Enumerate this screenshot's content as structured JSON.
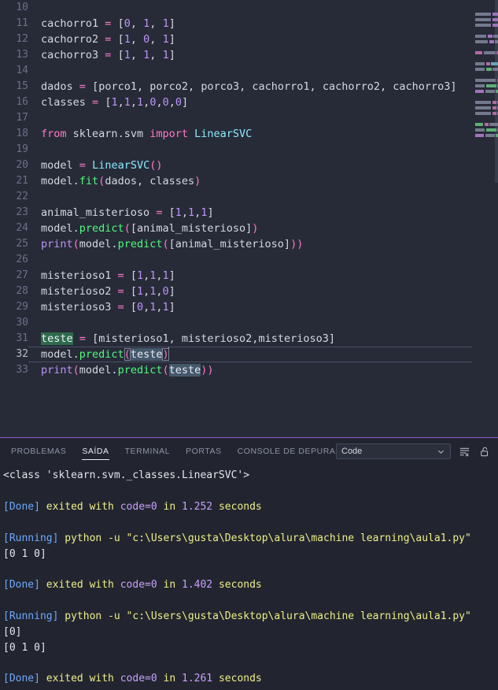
{
  "editor": {
    "language": "python",
    "first_visible_line": 10,
    "cursor_line": 32,
    "lines": [
      {
        "n": "10",
        "text": ""
      },
      {
        "n": "11",
        "text": "cachorro1 = [0, 1, 1]"
      },
      {
        "n": "12",
        "text": "cachorro2 = [1, 0, 1]"
      },
      {
        "n": "13",
        "text": "cachorro3 = [1, 1, 1]"
      },
      {
        "n": "14",
        "text": ""
      },
      {
        "n": "15",
        "text": "dados = [porco1, porco2, porco3, cachorro1, cachorro2, cachorro3]"
      },
      {
        "n": "16",
        "text": "classes = [1,1,1,0,0,0]"
      },
      {
        "n": "17",
        "text": ""
      },
      {
        "n": "18",
        "text": "from sklearn.svm import LinearSVC"
      },
      {
        "n": "19",
        "text": ""
      },
      {
        "n": "20",
        "text": "model = LinearSVC()"
      },
      {
        "n": "21",
        "text": "model.fit(dados, classes)"
      },
      {
        "n": "22",
        "text": ""
      },
      {
        "n": "23",
        "text": "animal_misterioso = [1,1,1]"
      },
      {
        "n": "24",
        "text": "model.predict([animal_misterioso])"
      },
      {
        "n": "25",
        "text": "print(model.predict([animal_misterioso]))"
      },
      {
        "n": "26",
        "text": ""
      },
      {
        "n": "27",
        "text": "misterioso1 = [1,1,1]"
      },
      {
        "n": "28",
        "text": "misterioso2 = [1,1,0]"
      },
      {
        "n": "29",
        "text": "misterioso3 = [0,1,1]"
      },
      {
        "n": "30",
        "text": ""
      },
      {
        "n": "31",
        "text": "teste = [misterioso1, misterioso2,misterioso3]"
      },
      {
        "n": "32",
        "text": "model.predict(teste)"
      },
      {
        "n": "33",
        "text": "print(model.predict(teste))"
      }
    ],
    "selected_word": "teste",
    "colors": {
      "background": "#272b38",
      "keyword": "#ff79c6",
      "function": "#50fa7b",
      "class": "#8be9fd",
      "number": "#bd93f9",
      "text": "#d5d8e0",
      "line_number": "#6b7089",
      "selection": "#2e6b4d",
      "word_highlight": "#44586b"
    }
  },
  "panel": {
    "tabs": [
      {
        "label": "PROBLEMAS",
        "active": false
      },
      {
        "label": "SAÍDA",
        "active": true
      },
      {
        "label": "TERMINAL",
        "active": false
      },
      {
        "label": "PORTAS",
        "active": false
      },
      {
        "label": "CONSOLE DE DEPURAÇÃO",
        "active": false
      }
    ],
    "output_selector": {
      "value": "Code",
      "chevron": "chevron-down-icon"
    },
    "actions": [
      {
        "name": "clear-output-icon",
        "title": "Limpar Saída"
      },
      {
        "name": "lock-scroll-icon",
        "title": "Ativar Rolagem Automática"
      }
    ],
    "output_lines": [
      {
        "type": "plain",
        "text": "<class 'sklearn.svm._classes.LinearSVC'>"
      },
      {
        "type": "blank",
        "text": ""
      },
      {
        "type": "done",
        "tag": "[Done]",
        "mid": " exited with ",
        "code": "code=0",
        "in": " in ",
        "time": "1.252",
        "unit": " seconds"
      },
      {
        "type": "blank",
        "text": ""
      },
      {
        "type": "running",
        "tag": "[Running]",
        "cmd": " python -u \"c:\\Users\\gusta\\Desktop\\alura\\machine learning\\aula1.py\""
      },
      {
        "type": "plain",
        "text": "[0 1 0]"
      },
      {
        "type": "blank",
        "text": ""
      },
      {
        "type": "done",
        "tag": "[Done]",
        "mid": " exited with ",
        "code": "code=0",
        "in": " in ",
        "time": "1.402",
        "unit": " seconds"
      },
      {
        "type": "blank",
        "text": ""
      },
      {
        "type": "running",
        "tag": "[Running]",
        "cmd": " python -u \"c:\\Users\\gusta\\Desktop\\alura\\machine learning\\aula1.py\""
      },
      {
        "type": "plain",
        "text": "[0]"
      },
      {
        "type": "plain",
        "text": "[0 1 0]"
      },
      {
        "type": "blank",
        "text": ""
      },
      {
        "type": "done",
        "tag": "[Done]",
        "mid": " exited with ",
        "code": "code=0",
        "in": " in ",
        "time": "1.261",
        "unit": " seconds"
      }
    ],
    "colors": {
      "background": "#22252f",
      "accent_border": "#8a5ccc",
      "done_tag": "#6ea8ff",
      "yellow": "#eeee88",
      "purple": "#c8a0ff"
    }
  },
  "minimap": {
    "rows": [
      [],
      [
        [
          20,
          "#7b8196"
        ],
        [
          12,
          "#b07acc"
        ],
        [
          8,
          "#7b8196"
        ]
      ],
      [
        [
          20,
          "#7b8196"
        ],
        [
          12,
          "#b07acc"
        ],
        [
          8,
          "#7b8196"
        ]
      ],
      [
        [
          20,
          "#7b8196"
        ],
        [
          12,
          "#b07acc"
        ],
        [
          8,
          "#7b8196"
        ]
      ],
      [],
      [
        [
          14,
          "#7b8196"
        ],
        [
          6,
          "#b07acc"
        ],
        [
          20,
          "#7b8196"
        ]
      ],
      [
        [
          16,
          "#7b8196"
        ],
        [
          6,
          "#b07acc"
        ],
        [
          12,
          "#7b8196"
        ]
      ],
      [],
      [
        [
          9,
          "#c06fae"
        ],
        [
          15,
          "#7b8196"
        ],
        [
          11,
          "#c06fae"
        ],
        [
          10,
          "#6fb3c4"
        ]
      ],
      [],
      [
        [
          12,
          "#7b8196"
        ],
        [
          5,
          "#c06fae"
        ],
        [
          16,
          "#6fb3c4"
        ]
      ],
      [
        [
          12,
          "#7b8196"
        ],
        [
          7,
          "#5fbf78"
        ],
        [
          16,
          "#7b8196"
        ]
      ],
      [],
      [
        [
          26,
          "#7b8196"
        ],
        [
          5,
          "#c06fae"
        ],
        [
          10,
          "#b07acc"
        ]
      ],
      [
        [
          12,
          "#7b8196"
        ],
        [
          13,
          "#5fbf78"
        ],
        [
          18,
          "#7b8196"
        ]
      ],
      [
        [
          11,
          "#b07acc"
        ],
        [
          12,
          "#7b8196"
        ],
        [
          13,
          "#5fbf78"
        ],
        [
          14,
          "#7b8196"
        ]
      ],
      [],
      [
        [
          20,
          "#7b8196"
        ],
        [
          5,
          "#c06fae"
        ],
        [
          10,
          "#b07acc"
        ]
      ],
      [
        [
          20,
          "#7b8196"
        ],
        [
          5,
          "#c06fae"
        ],
        [
          10,
          "#b07acc"
        ]
      ],
      [
        [
          20,
          "#7b8196"
        ],
        [
          5,
          "#c06fae"
        ],
        [
          10,
          "#b07acc"
        ]
      ],
      [],
      [
        [
          10,
          "#5fbf78"
        ],
        [
          5,
          "#c06fae"
        ],
        [
          26,
          "#7b8196"
        ]
      ],
      [
        [
          12,
          "#7b8196"
        ],
        [
          13,
          "#5fbf78"
        ],
        [
          9,
          "#7b8196"
        ]
      ],
      [
        [
          11,
          "#b07acc"
        ],
        [
          12,
          "#7b8196"
        ],
        [
          13,
          "#5fbf78"
        ],
        [
          7,
          "#7b8196"
        ]
      ]
    ]
  }
}
